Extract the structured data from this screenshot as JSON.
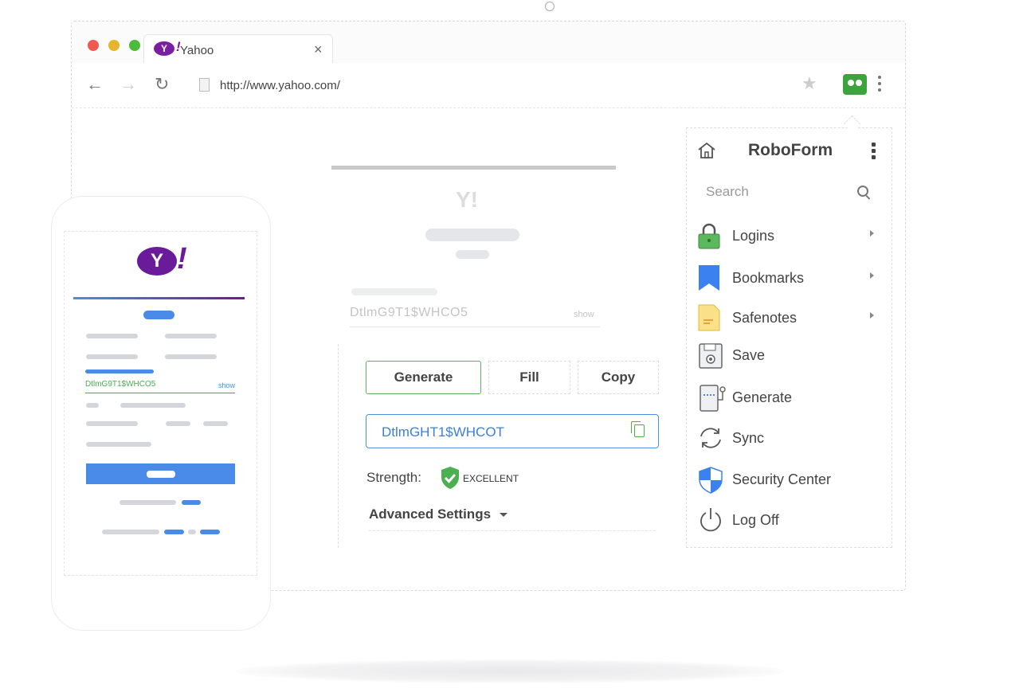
{
  "browser": {
    "tab_title": "Yahoo",
    "tab_logo": "Y",
    "tab_logo_mark": "!",
    "tab_close": "×",
    "url": "http://www.yahoo.com/",
    "nav": {
      "back": "←",
      "forward": "→",
      "reload": "↻"
    },
    "star": "★"
  },
  "page": {
    "password_value": "DtlmG9T1$WHCO5",
    "password_show": "show",
    "ghost_logo": "Y!"
  },
  "generator": {
    "buttons": {
      "generate": "Generate",
      "fill": "Fill",
      "copy": "Copy"
    },
    "generated_password": "DtlmGHT1$WHCOT",
    "strength_label": "Strength:",
    "strength_value": "EXCELLENT",
    "advanced_label": "Advanced Settings"
  },
  "roboform": {
    "title": "RoboForm",
    "search_placeholder": "Search",
    "items": [
      {
        "label": "Logins",
        "icon": "padlock-icon",
        "submenu": true
      },
      {
        "label": "Bookmarks",
        "icon": "bookmark-icon",
        "submenu": true
      },
      {
        "label": "Safenotes",
        "icon": "note-icon",
        "submenu": true
      },
      {
        "label": "Save",
        "icon": "floppy-disk-icon",
        "submenu": false
      },
      {
        "label": "Generate",
        "icon": "password-generator-icon",
        "submenu": false
      },
      {
        "label": "Sync",
        "icon": "sync-icon",
        "submenu": false
      },
      {
        "label": "Security Center",
        "icon": "shield-icon",
        "submenu": false
      },
      {
        "label": "Log Off",
        "icon": "power-icon",
        "submenu": false
      }
    ]
  },
  "phone": {
    "logo": "Y",
    "logo_mark": "!",
    "password_value": "DtlmG9T1$WHCO5",
    "password_show": "show"
  },
  "colors": {
    "accent_green": "#5cb85c",
    "accent_blue": "#4a90e2",
    "yahoo_purple": "#6a1b9a"
  }
}
